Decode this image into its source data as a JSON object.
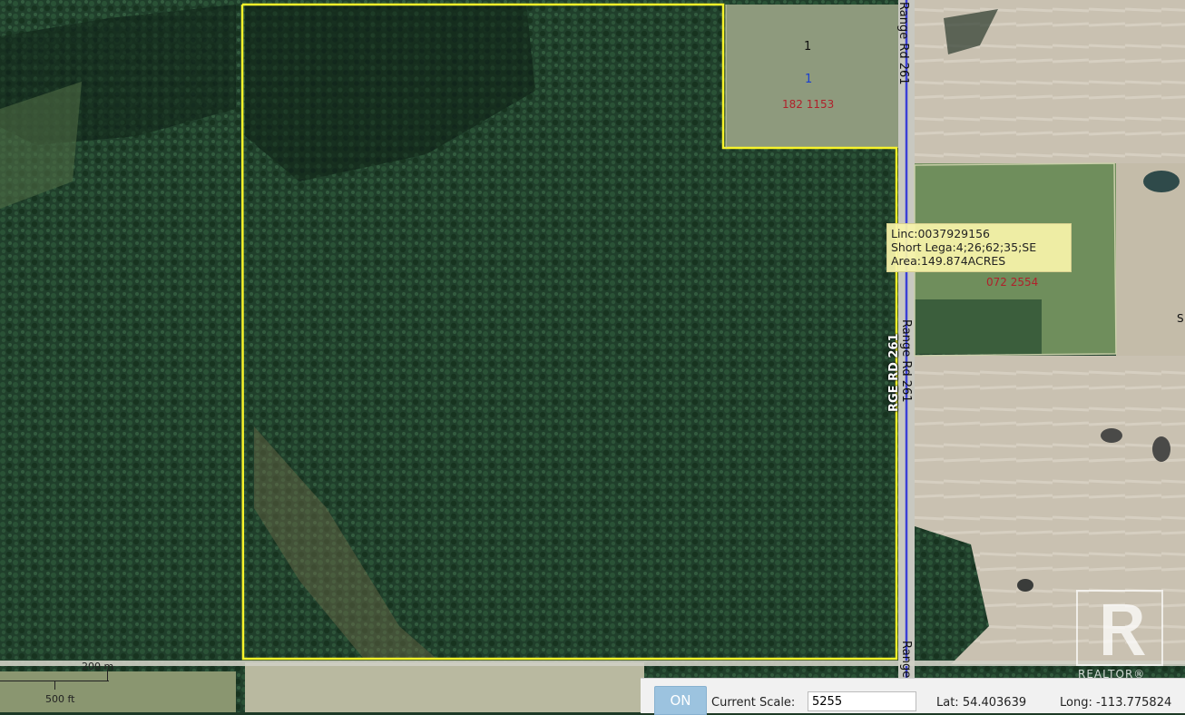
{
  "parcel": {
    "linc": "Linc:0037929156",
    "short_legal": "Short Lega:4;26;62;35;SE",
    "area": "Area:149.874ACRES"
  },
  "plan_labels": [
    "182 1153",
    "072 2554"
  ],
  "lot_labels": [
    "1",
    "1"
  ],
  "road_labels": [
    "Range Rd 261",
    "Range Rd 261",
    "RGE RD 261",
    "Range"
  ],
  "scale_bar": {
    "metric": "200 m",
    "imperial": "500 ft"
  },
  "toolbar": {
    "on_label": "ON",
    "scale_label": "Current Scale:",
    "scale_value": "5255",
    "lat": "Lat: 54.403639",
    "long": "Long: -113.775824"
  },
  "logo": {
    "text": "REALTOR®"
  },
  "partial_text": "S",
  "colors": {
    "boundary": "#f7f32a",
    "road_line": "#3b3fd6",
    "info_bg": "#f8f4aa"
  }
}
